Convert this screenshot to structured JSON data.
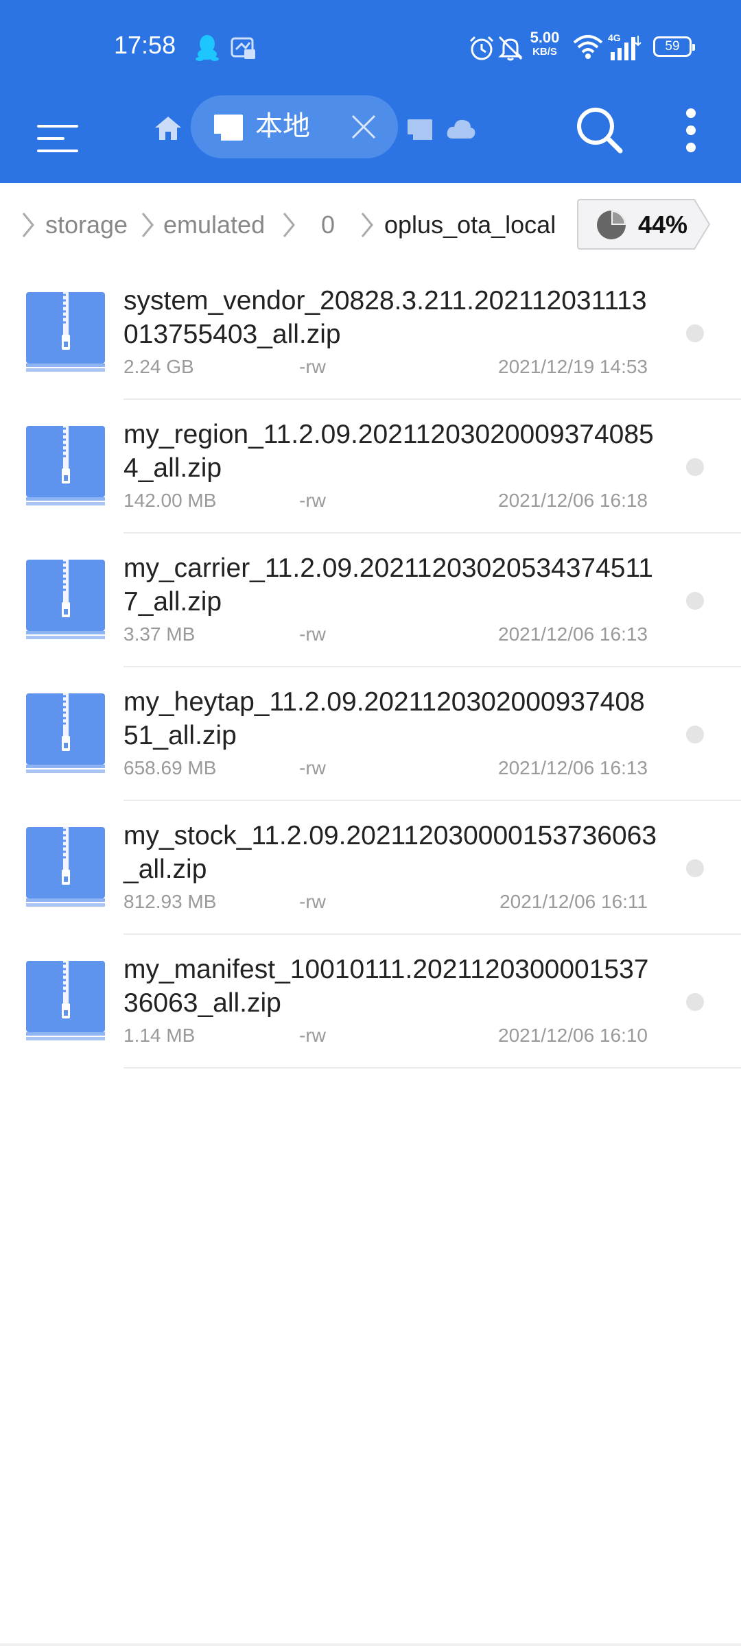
{
  "status_bar": {
    "time": "17:58",
    "net_speed_value": "5.00",
    "net_speed_unit": "KB/S",
    "network_type": "4G",
    "battery": "59",
    "icons": [
      "qq-icon",
      "notification-icon",
      "alarm-icon",
      "mute-icon",
      "wifi-icon",
      "cellular-signal-icon",
      "battery-icon"
    ]
  },
  "app_bar": {
    "active_tab_label": "本地",
    "icons": [
      "menu-icon",
      "home-icon",
      "sd-card-icon",
      "close-icon",
      "cloud-icon",
      "search-icon",
      "more-vert-icon"
    ]
  },
  "breadcrumb": {
    "items": [
      "storage",
      "emulated",
      "0",
      "oplus_ota_local"
    ],
    "storage_usage": "44%"
  },
  "colors": {
    "accent": "#2c74e3",
    "tab_bg": "#4f8deb",
    "zip_icon": "#5e93ee",
    "meta_text": "#9a9a9a"
  },
  "files": [
    {
      "name": "system_vendor_20828.3.211.202112031113013755403_all.zip",
      "size": "2.24 GB",
      "perm": "-rw",
      "date": "2021/12/19 14:53"
    },
    {
      "name": "my_region_11.2.09.202112030200093740854_all.zip",
      "size": "142.00 MB",
      "perm": "-rw",
      "date": "2021/12/06 16:18"
    },
    {
      "name": "my_carrier_11.2.09.202112030205343745117_all.zip",
      "size": "3.37 MB",
      "perm": "-rw",
      "date": "2021/12/06 16:13"
    },
    {
      "name": "my_heytap_11.2.09.202112030200093740851_all.zip",
      "size": "658.69 MB",
      "perm": "-rw",
      "date": "2021/12/06 16:13"
    },
    {
      "name": "my_stock_11.2.09.202112030000153736063_all.zip",
      "size": "812.93 MB",
      "perm": "-rw",
      "date": "2021/12/06 16:11"
    },
    {
      "name": "my_manifest_10010111.202112030000153736063_all.zip",
      "size": "1.14 MB",
      "perm": "-rw",
      "date": "2021/12/06 16:10"
    }
  ]
}
